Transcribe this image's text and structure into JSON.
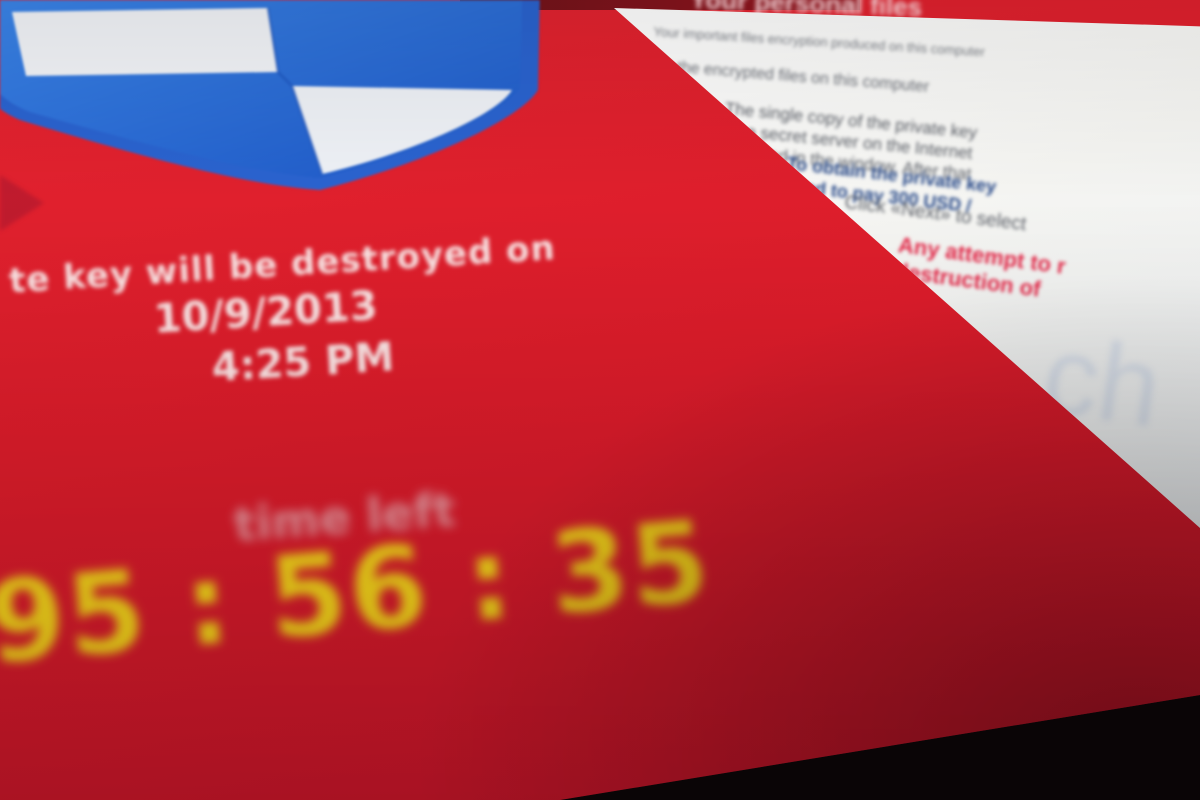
{
  "window": {
    "header_text": "Your personal files"
  },
  "left": {
    "destroy_line": "te key will be destroyed on",
    "destroy_date": "10/9/2013",
    "destroy_time": "4:25 PM",
    "time_left_label": "time left",
    "countdown": {
      "hours": "95",
      "minutes": "56",
      "seconds": "35",
      "separator": ":"
    }
  },
  "panel": {
    "top_line": "Your important files encryption produced on this computer",
    "line1": "the encrypted files on this computer",
    "line2": "The single copy of the private key\non a secret server on the Internet\nspecified in the window. After that",
    "line3": "To obtain the private key\nneed to pay 300 USD /",
    "line4": "Click «Next» to select",
    "line5": "Any attempt to r\ndestruction of",
    "watermark": "ch"
  },
  "colors": {
    "screen_red": "#dc1c2a",
    "countdown_yellow": "#f3d11a",
    "warning_red": "#e42a4a",
    "shield_blue": "#2b6fd6",
    "heading_blue": "#2a4b8a"
  },
  "icons": {
    "shield": "shield-icon",
    "arrow": "back-arrow-icon"
  }
}
